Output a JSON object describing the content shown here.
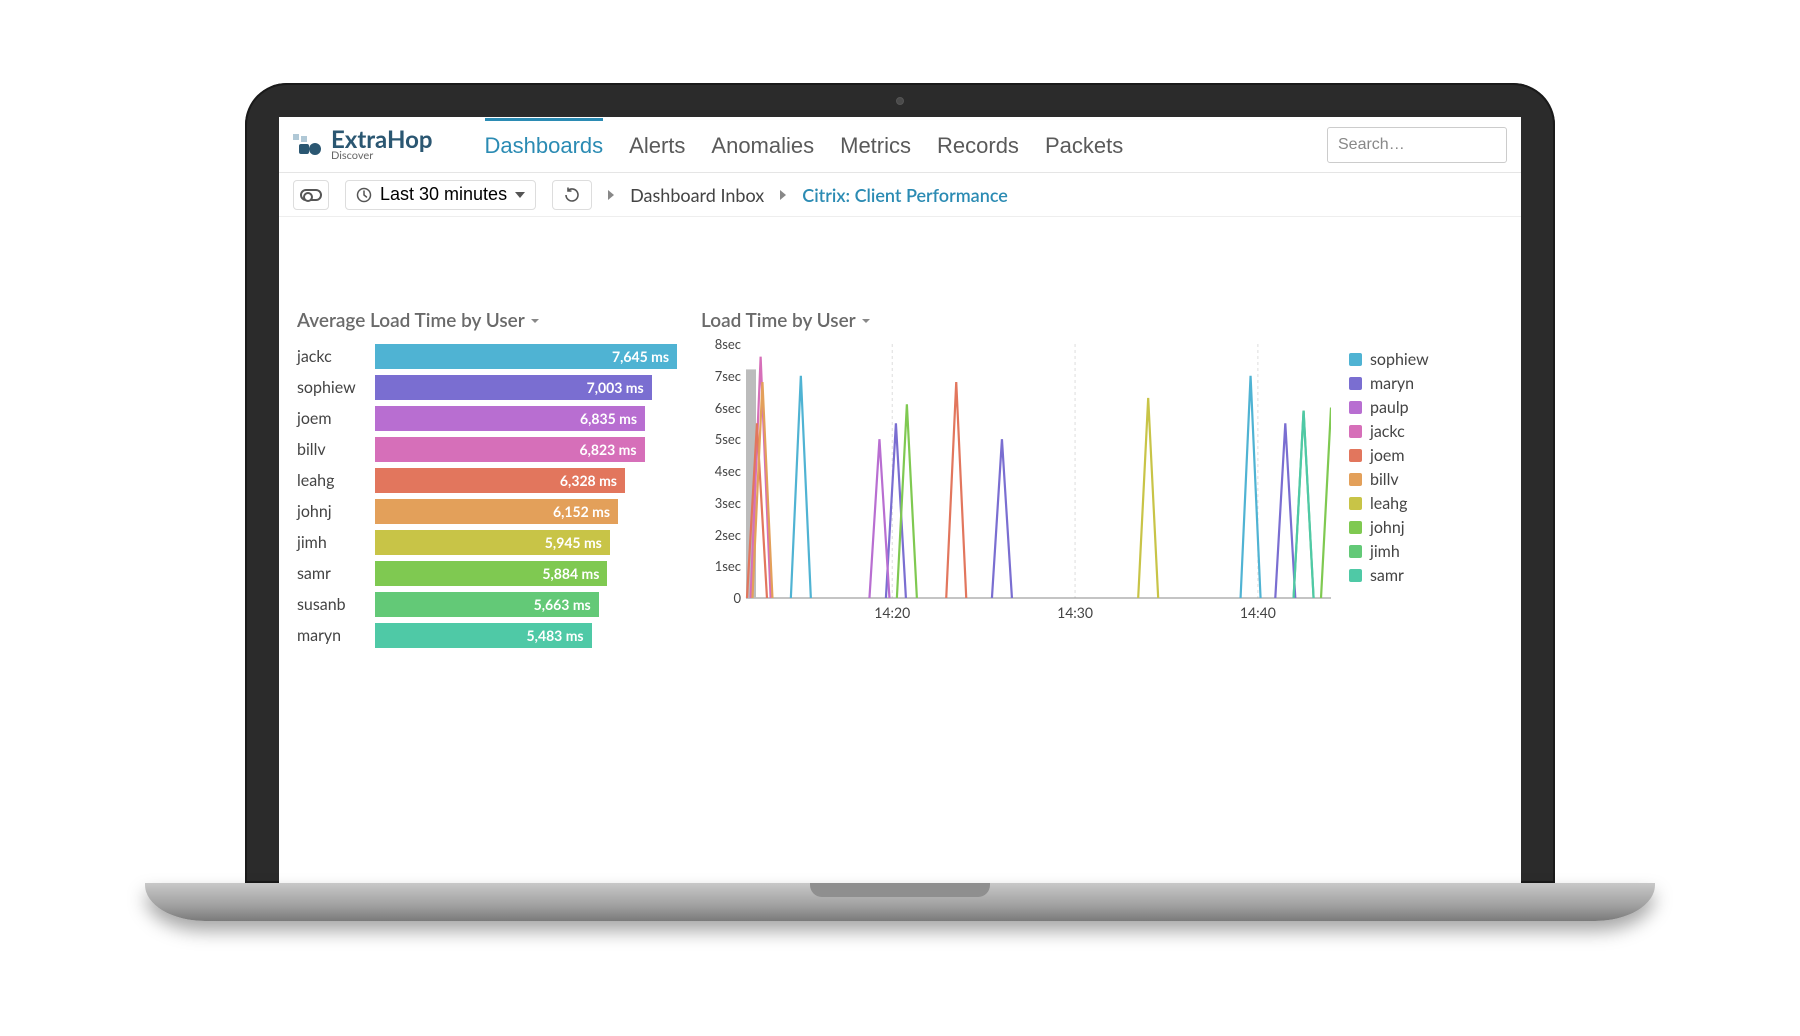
{
  "brand": {
    "name": "ExtraHop",
    "subtitle": "Discover"
  },
  "nav": {
    "items": [
      "Dashboards",
      "Alerts",
      "Anomalies",
      "Metrics",
      "Records",
      "Packets"
    ],
    "active": 0
  },
  "search": {
    "placeholder": "Search…"
  },
  "subbar": {
    "time_range": "Last 30 minutes",
    "breadcrumb_root": "Dashboard Inbox",
    "breadcrumb_current": "Citrix: Client Performance"
  },
  "panel1": {
    "title": "Average Load Time by User"
  },
  "panel2": {
    "title": "Load Time by User"
  },
  "chart_data": [
    {
      "type": "bar",
      "title": "Average Load Time by User",
      "xlabel": "",
      "ylabel": "",
      "categories": [
        "jackc",
        "sophiew",
        "joem",
        "billv",
        "leahg",
        "johnj",
        "jimh",
        "samr",
        "susanb",
        "maryn"
      ],
      "values": [
        7645,
        7003,
        6835,
        6823,
        6328,
        6152,
        5945,
        5884,
        5663,
        5483
      ],
      "value_labels": [
        "7,645 ms",
        "7,003 ms",
        "6,835 ms",
        "6,823 ms",
        "6,328 ms",
        "6,152 ms",
        "5,945 ms",
        "5,884 ms",
        "5,663 ms",
        "5,483 ms"
      ],
      "colors": [
        "#4fb3d3",
        "#7a6ed1",
        "#b86ed1",
        "#d66fb9",
        "#e2765d",
        "#e3a05a",
        "#c8c447",
        "#7fc951",
        "#63c977",
        "#4fc9a6"
      ],
      "max": 7645
    },
    {
      "type": "line",
      "title": "Load Time by User",
      "xlabel": "",
      "ylabel": "sec",
      "x_ticks": [
        "14:20",
        "14:30",
        "14:40"
      ],
      "y_ticks": [
        "0",
        "1sec",
        "2sec",
        "3sec",
        "4sec",
        "5sec",
        "6sec",
        "7sec",
        "8sec"
      ],
      "ylim": [
        0,
        8
      ],
      "xrange": [
        "14:12",
        "14:44"
      ],
      "legend": [
        "sophiew",
        "maryn",
        "paulp",
        "jackc",
        "joem",
        "billv",
        "leahg",
        "johnj",
        "jimh",
        "samr"
      ],
      "legend_colors": [
        "#4fb3d3",
        "#7a6ed1",
        "#b86ed1",
        "#d66fb9",
        "#e2765d",
        "#e3a05a",
        "#c8c447",
        "#7fc951",
        "#63c977",
        "#4fc9a6"
      ],
      "series": [
        {
          "name": "sophiew",
          "color": "#4fb3d3",
          "points": [
            [
              "14:15",
              7.0
            ],
            [
              "14:39.6",
              7.0
            ]
          ]
        },
        {
          "name": "maryn",
          "color": "#7a6ed1",
          "points": [
            [
              "14:20.2",
              5.5
            ],
            [
              "14:26",
              5.0
            ],
            [
              "14:41.5",
              5.5
            ]
          ]
        },
        {
          "name": "paulp",
          "color": "#b86ed1",
          "points": [
            [
              "14:19.3",
              5.0
            ]
          ]
        },
        {
          "name": "jackc",
          "color": "#d66fb9",
          "points": [
            [
              "14:12.8",
              7.6
            ]
          ]
        },
        {
          "name": "joem",
          "color": "#e2765d",
          "points": [
            [
              "14:23.5",
              6.8
            ],
            [
              "14:12.6",
              5.5
            ]
          ]
        },
        {
          "name": "billv",
          "color": "#e3a05a",
          "points": [
            [
              "14:12.9",
              6.8
            ]
          ]
        },
        {
          "name": "leahg",
          "color": "#c8c447",
          "points": [
            [
              "14:34",
              6.3
            ]
          ]
        },
        {
          "name": "johnj",
          "color": "#7fc951",
          "points": [
            [
              "14:20.8",
              6.1
            ],
            [
              "14:44",
              6.0
            ]
          ]
        },
        {
          "name": "jimh",
          "color": "#63c977",
          "points": [
            [
              "14:42.5",
              5.9
            ]
          ]
        },
        {
          "name": "samr",
          "color": "#4fc9a6",
          "points": [
            [
              "14:42.5",
              5.9
            ]
          ]
        }
      ]
    }
  ]
}
